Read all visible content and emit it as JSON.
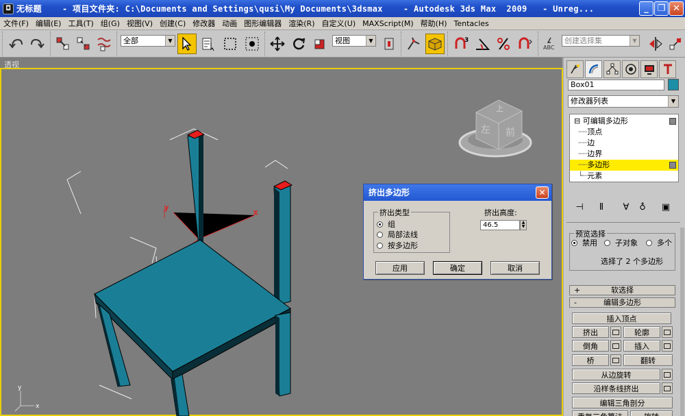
{
  "window": {
    "app_icon": "3dsmax-icon",
    "title": "无标题    - 项目文件夹: C:\\Documents and Settings\\qusi\\My Documents\\3dsmax    - Autodesk 3ds Max  2009   - Unreg...",
    "buttons": {
      "minimize": "_",
      "maximize": "❐",
      "close": "✕"
    }
  },
  "menu": [
    "文件(F)",
    "编辑(E)",
    "工具(T)",
    "组(G)",
    "视图(V)",
    "创建(C)",
    "修改器",
    "动画",
    "图形编辑器",
    "渲染(R)",
    "自定义(U)",
    "MAXScript(M)",
    "帮助(H)",
    "Tentacles"
  ],
  "toolbar": {
    "selection_filter": "全部",
    "reference_coord": "视图",
    "named_selection_placeholder": "创建选择集",
    "snap_label": "3"
  },
  "viewport": {
    "label": "透视",
    "viewcube": {
      "top": "上",
      "front": "前",
      "left": "左"
    },
    "axis_labels": {
      "x": "x",
      "y": "y"
    },
    "colors": {
      "background": "#7d7d7d",
      "chair": "#1a7f96",
      "selected_poly": "#e81d1d",
      "frame": "#e8d000"
    }
  },
  "dialog": {
    "title": "挤出多边形",
    "group_label": "挤出类型",
    "options": [
      "组",
      "局部法线",
      "按多边形"
    ],
    "selected_option": "组",
    "height_label": "挤出高度:",
    "height_value": "46.5",
    "buttons": {
      "apply": "应用",
      "ok": "确定",
      "cancel": "取消"
    }
  },
  "panel": {
    "object_name": "Box01",
    "object_color": "#1c8ea6",
    "modifier_list": "修改器列表",
    "stack": [
      {
        "label": "可编辑多边形",
        "level": 0
      },
      {
        "label": "顶点",
        "level": 1
      },
      {
        "label": "边",
        "level": 1
      },
      {
        "label": "边界",
        "level": 1
      },
      {
        "label": "多边形",
        "level": 1,
        "selected": true
      },
      {
        "label": "元素",
        "level": 1
      }
    ],
    "preview_selection": {
      "title": "预览选择",
      "options": [
        "禁用",
        "子对象",
        "多个"
      ],
      "selected": "禁用",
      "status": "选择了 2 个多边形"
    },
    "rollouts": {
      "soft_selection": "软选择",
      "edit_polygons": "编辑多边形"
    },
    "rollout_signs": {
      "collapsed": "+",
      "expanded": "-"
    },
    "edit_buttons": {
      "insert_vertex": "插入顶点",
      "extrude": "挤出",
      "outline": "轮廓",
      "bevel": "倒角",
      "inset": "插入",
      "bridge": "桥",
      "flip": "翻转",
      "hinge": "从边旋转",
      "extrude_spline": "沿样条线挤出",
      "edit_triangulation": "编辑三角剖分",
      "retriangulate": "重复三角算法",
      "turn": "旋转"
    }
  }
}
